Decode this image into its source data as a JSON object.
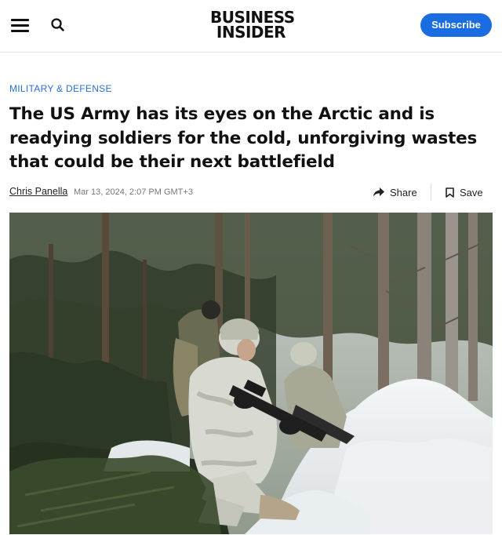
{
  "header": {
    "logo_line1": "BUSINESS",
    "logo_line2": "INSIDER",
    "subscribe_label": "Subscribe",
    "menu_icon": "hamburger-menu-icon",
    "search_icon": "search-icon"
  },
  "article": {
    "category": "MILITARY & DEFENSE",
    "headline": "The US Army has its eyes on the Arctic and is readying soldiers for the cold, unforgiving wastes that could be their next battlefield",
    "author": "Chris Panella",
    "date": "Mar 13, 2024, 2:07 PM GMT+3",
    "share_label": "Share",
    "save_label": "Save"
  },
  "colors": {
    "accent": "#1a6de0",
    "category": "#2a6fd6"
  }
}
